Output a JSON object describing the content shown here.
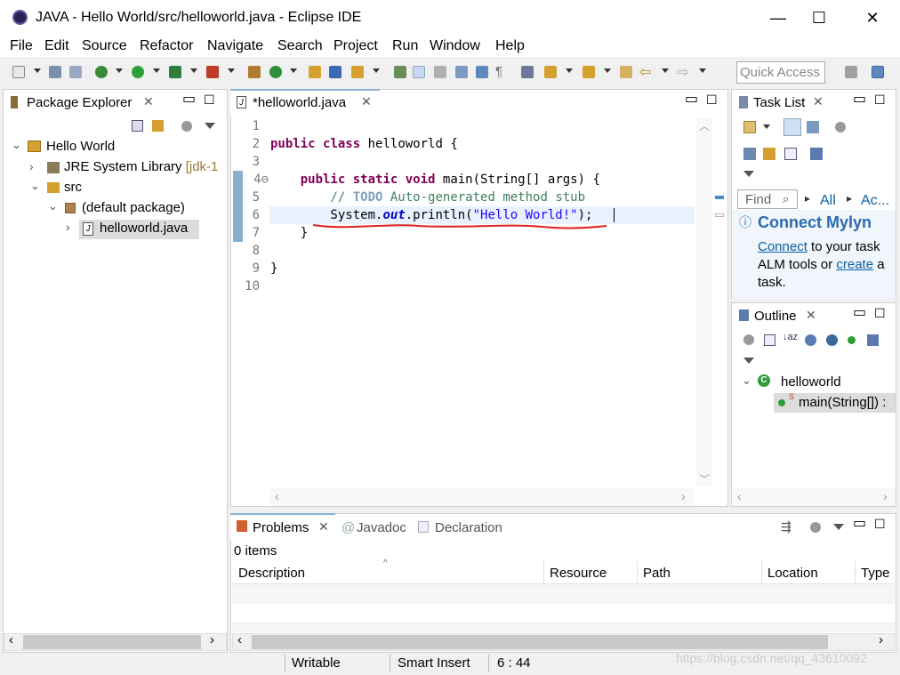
{
  "window": {
    "title": "JAVA - Hello World/src/helloworld.java - Eclipse IDE",
    "minimize": "—",
    "maximize": "☐",
    "close": "✕"
  },
  "menu": [
    "File",
    "Edit",
    "Source",
    "Refactor",
    "Navigate",
    "Search",
    "Project",
    "Run",
    "Window",
    "Help"
  ],
  "quick_access": {
    "placeholder": "Quick Access"
  },
  "package_explorer": {
    "tab": "Package Explorer",
    "tree": [
      {
        "label": "Hello World",
        "level": 0,
        "expanded": true
      },
      {
        "label": "JRE System Library",
        "suffix": "[jdk-1",
        "level": 1,
        "expanded": false
      },
      {
        "label": "src",
        "level": 1,
        "expanded": true
      },
      {
        "label": "(default package)",
        "level": 2,
        "expanded": true
      },
      {
        "label": "helloworld.java",
        "level": 3,
        "expanded": false,
        "selected": true
      }
    ]
  },
  "editor": {
    "tab": "*helloworld.java",
    "line_numbers": [
      "1",
      "2",
      "3",
      "4⊖",
      "5",
      "6",
      "7",
      "8",
      "9",
      "10"
    ]
  },
  "task_list": {
    "tab": "Task List",
    "find_placeholder": "Find",
    "filter_all": "All",
    "filter_ac": "Ac...",
    "mylyn_title": "Connect Mylyn",
    "mylyn_connect": "Connect",
    "mylyn_text1": " to your task",
    "mylyn_text2": "ALM tools or ",
    "mylyn_create": "create",
    "mylyn_text3": " a",
    "mylyn_text4": "task."
  },
  "outline": {
    "tab": "Outline",
    "class_name": "helloworld",
    "method": "main(String[]) :"
  },
  "bottom": {
    "tabs": [
      "Problems",
      "Javadoc",
      "Declaration"
    ],
    "items_count": "0 items",
    "columns": [
      "Description",
      "Resource",
      "Path",
      "Location",
      "Type"
    ]
  },
  "status": {
    "writable": "Writable",
    "insert_mode": "Smart Insert",
    "position": "6 : 44",
    "watermark": "https://blog.csdn.net/qq_43610092"
  }
}
